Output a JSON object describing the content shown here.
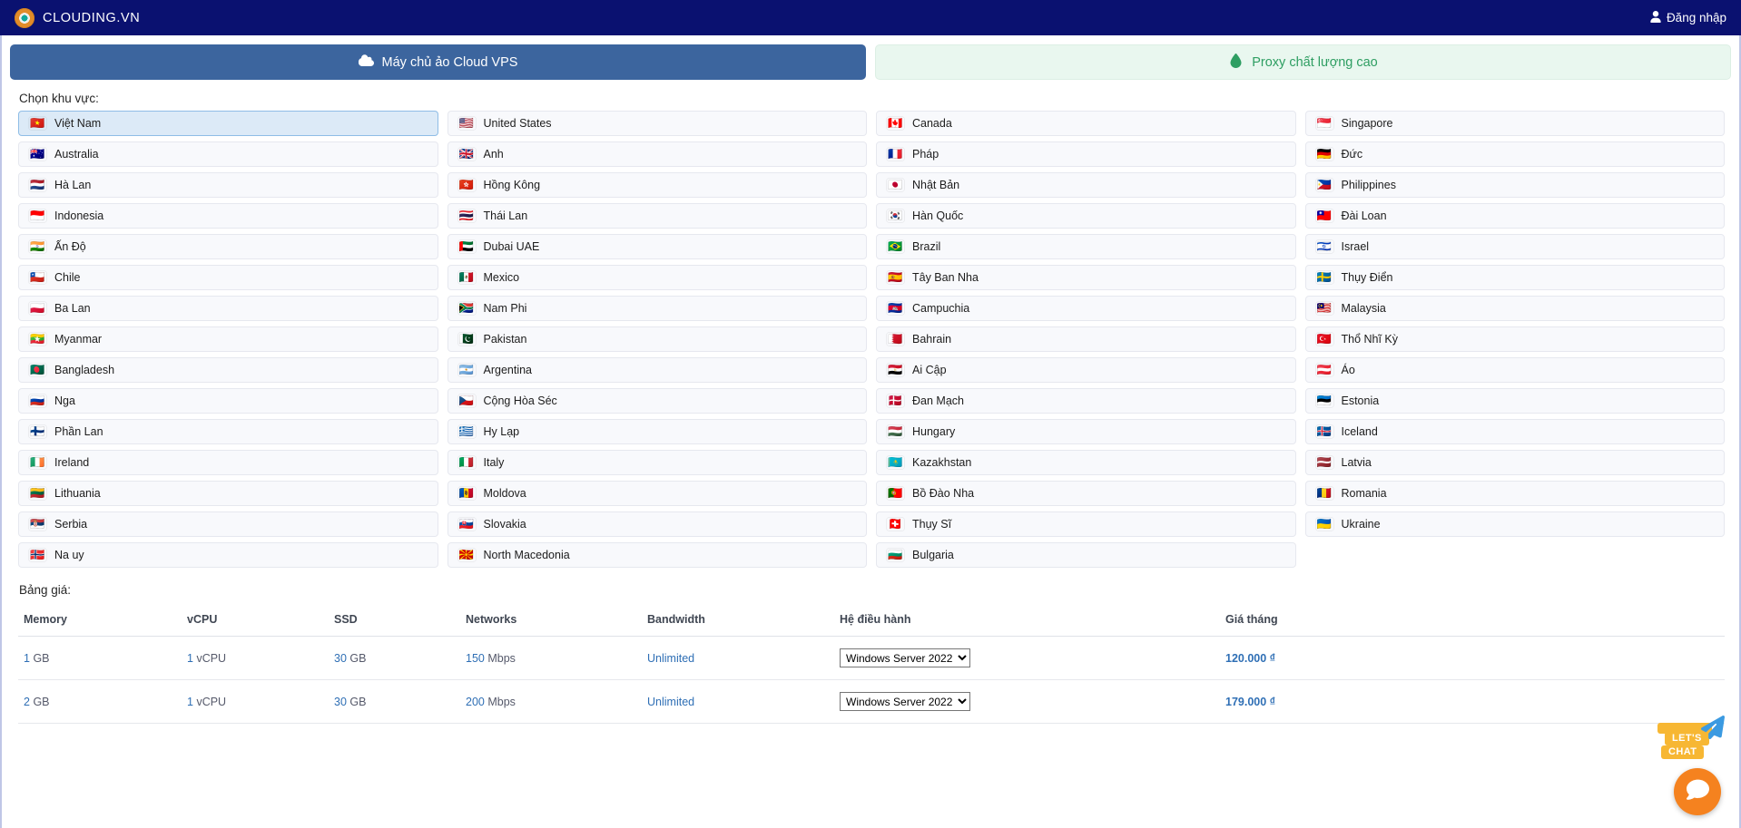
{
  "navbar": {
    "brand": "CLOUDING.VN",
    "brand_logo_icon": "clouding-logo-icon",
    "login_label": "Đăng nhập",
    "login_icon": "user-icon",
    "background_color": "#0a1170"
  },
  "tabs": [
    {
      "label": "Máy chủ ảo Cloud VPS",
      "icon": "cloud-icon",
      "active": true,
      "accent": "#3c659e"
    },
    {
      "label": "Proxy chất lượng cao",
      "icon": "droplet-icon",
      "active": false,
      "accent": "#2e9e62"
    }
  ],
  "region_section": {
    "title": "Chọn khu vực:",
    "selected": "Việt Nam",
    "items": [
      {
        "name": "Việt Nam",
        "flag": "🇻🇳",
        "selected": true
      },
      {
        "name": "United States",
        "flag": "🇺🇸",
        "selected": false
      },
      {
        "name": "Canada",
        "flag": "🇨🇦",
        "selected": false
      },
      {
        "name": "Singapore",
        "flag": "🇸🇬",
        "selected": false
      },
      {
        "name": "Australia",
        "flag": "🇦🇺",
        "selected": false
      },
      {
        "name": "Anh",
        "flag": "🇬🇧",
        "selected": false
      },
      {
        "name": "Pháp",
        "flag": "🇫🇷",
        "selected": false
      },
      {
        "name": "Đức",
        "flag": "🇩🇪",
        "selected": false
      },
      {
        "name": "Hà Lan",
        "flag": "🇳🇱",
        "selected": false
      },
      {
        "name": "Hồng Kông",
        "flag": "🇭🇰",
        "selected": false
      },
      {
        "name": "Nhật Bản",
        "flag": "🇯🇵",
        "selected": false
      },
      {
        "name": "Philippines",
        "flag": "🇵🇭",
        "selected": false
      },
      {
        "name": "Indonesia",
        "flag": "🇮🇩",
        "selected": false
      },
      {
        "name": "Thái Lan",
        "flag": "🇹🇭",
        "selected": false
      },
      {
        "name": "Hàn Quốc",
        "flag": "🇰🇷",
        "selected": false
      },
      {
        "name": "Đài Loan",
        "flag": "🇹🇼",
        "selected": false
      },
      {
        "name": "Ấn Độ",
        "flag": "🇮🇳",
        "selected": false
      },
      {
        "name": "Dubai UAE",
        "flag": "🇦🇪",
        "selected": false
      },
      {
        "name": "Brazil",
        "flag": "🇧🇷",
        "selected": false
      },
      {
        "name": "Israel",
        "flag": "🇮🇱",
        "selected": false
      },
      {
        "name": "Chile",
        "flag": "🇨🇱",
        "selected": false
      },
      {
        "name": "Mexico",
        "flag": "🇲🇽",
        "selected": false
      },
      {
        "name": "Tây Ban Nha",
        "flag": "🇪🇸",
        "selected": false
      },
      {
        "name": "Thụy Điển",
        "flag": "🇸🇪",
        "selected": false
      },
      {
        "name": "Ba Lan",
        "flag": "🇵🇱",
        "selected": false
      },
      {
        "name": "Nam Phi",
        "flag": "🇿🇦",
        "selected": false
      },
      {
        "name": "Campuchia",
        "flag": "🇰🇭",
        "selected": false
      },
      {
        "name": "Malaysia",
        "flag": "🇲🇾",
        "selected": false
      },
      {
        "name": "Myanmar",
        "flag": "🇲🇲",
        "selected": false
      },
      {
        "name": "Pakistan",
        "flag": "🇵🇰",
        "selected": false
      },
      {
        "name": "Bahrain",
        "flag": "🇧🇭",
        "selected": false
      },
      {
        "name": "Thổ Nhĩ Kỳ",
        "flag": "🇹🇷",
        "selected": false
      },
      {
        "name": "Bangladesh",
        "flag": "🇧🇩",
        "selected": false
      },
      {
        "name": "Argentina",
        "flag": "🇦🇷",
        "selected": false
      },
      {
        "name": "Ai Cập",
        "flag": "🇪🇬",
        "selected": false
      },
      {
        "name": "Áo",
        "flag": "🇦🇹",
        "selected": false
      },
      {
        "name": "Nga",
        "flag": "🇷🇺",
        "selected": false
      },
      {
        "name": "Cộng Hòa Séc",
        "flag": "🇨🇿",
        "selected": false
      },
      {
        "name": "Đan Mạch",
        "flag": "🇩🇰",
        "selected": false
      },
      {
        "name": "Estonia",
        "flag": "🇪🇪",
        "selected": false
      },
      {
        "name": "Phần Lan",
        "flag": "🇫🇮",
        "selected": false
      },
      {
        "name": "Hy Lạp",
        "flag": "🇬🇷",
        "selected": false
      },
      {
        "name": "Hungary",
        "flag": "🇭🇺",
        "selected": false
      },
      {
        "name": "Iceland",
        "flag": "🇮🇸",
        "selected": false
      },
      {
        "name": "Ireland",
        "flag": "🇮🇪",
        "selected": false
      },
      {
        "name": "Italy",
        "flag": "🇮🇹",
        "selected": false
      },
      {
        "name": "Kazakhstan",
        "flag": "🇰🇿",
        "selected": false
      },
      {
        "name": "Latvia",
        "flag": "🇱🇻",
        "selected": false
      },
      {
        "name": "Lithuania",
        "flag": "🇱🇹",
        "selected": false
      },
      {
        "name": "Moldova",
        "flag": "🇲🇩",
        "selected": false
      },
      {
        "name": "Bồ Đào Nha",
        "flag": "🇵🇹",
        "selected": false
      },
      {
        "name": "Romania",
        "flag": "🇷🇴",
        "selected": false
      },
      {
        "name": "Serbia",
        "flag": "🇷🇸",
        "selected": false
      },
      {
        "name": "Slovakia",
        "flag": "🇸🇰",
        "selected": false
      },
      {
        "name": "Thụy Sĩ",
        "flag": "🇨🇭",
        "selected": false
      },
      {
        "name": "Ukraine",
        "flag": "🇺🇦",
        "selected": false
      },
      {
        "name": "Na uy",
        "flag": "🇳🇴",
        "selected": false
      },
      {
        "name": "North Macedonia",
        "flag": "🇲🇰",
        "selected": false
      },
      {
        "name": "Bulgaria",
        "flag": "🇧🇬",
        "selected": false
      }
    ]
  },
  "price_section": {
    "title": "Bảng giá:",
    "columns": [
      "Memory",
      "vCPU",
      "SSD",
      "Networks",
      "Bandwidth",
      "Hệ điều hành",
      "Giá tháng"
    ],
    "os_options": [
      "Windows Server 2022"
    ],
    "rows": [
      {
        "memory_value": "1",
        "memory_unit": "GB",
        "vcpu_value": "1",
        "vcpu_unit": "vCPU",
        "ssd_value": "30",
        "ssd_unit": "GB",
        "net_value": "150",
        "net_unit": "Mbps",
        "bandwidth": "Unlimited",
        "os": "Windows Server 2022",
        "price": "120.000 ₫"
      },
      {
        "memory_value": "2",
        "memory_unit": "GB",
        "vcpu_value": "1",
        "vcpu_unit": "vCPU",
        "ssd_value": "30",
        "ssd_unit": "GB",
        "net_value": "200",
        "net_unit": "Mbps",
        "bandwidth": "Unlimited",
        "os": "Windows Server 2022",
        "price": "179.000 ₫"
      }
    ]
  },
  "chat_widget": {
    "line1": "LET'S",
    "line2": "CHAT",
    "bubble_icon": "chat-bubble-icon",
    "plane_icon": "paper-plane-icon",
    "accent": "#f5821f"
  }
}
